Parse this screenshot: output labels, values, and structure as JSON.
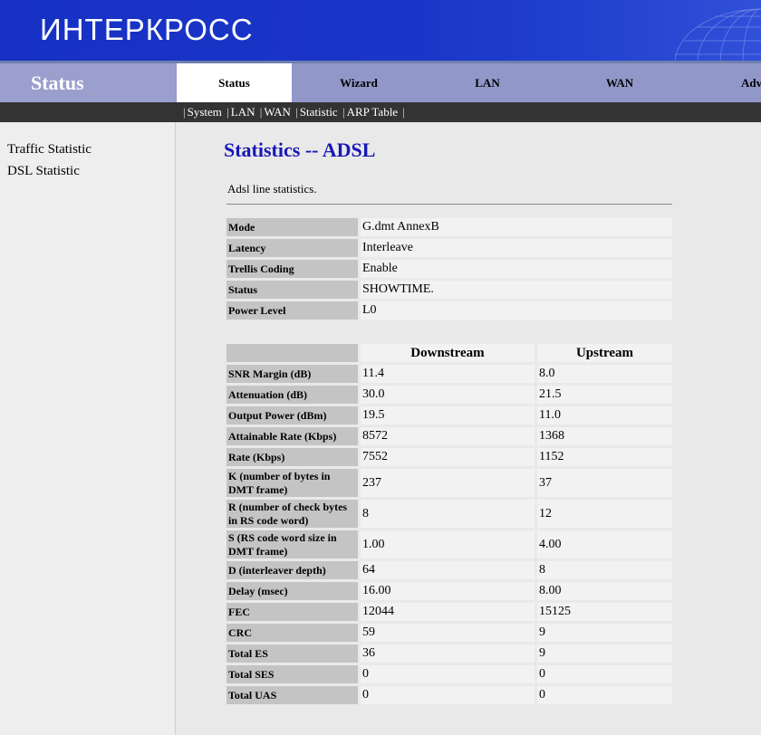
{
  "brand": {
    "logo_text": "ИНТЕРКРОСС"
  },
  "header": {
    "section_title": "Status"
  },
  "tabs": [
    {
      "label": "Status",
      "active": true
    },
    {
      "label": "Wizard",
      "active": false
    },
    {
      "label": "LAN",
      "active": false
    },
    {
      "label": "WAN",
      "active": false
    },
    {
      "label": "Adv",
      "active": false
    }
  ],
  "subnav": [
    "System",
    "LAN",
    "WAN",
    "Statistic",
    "ARP Table"
  ],
  "sidebar": {
    "items": [
      "Traffic Statistic",
      "DSL Statistic"
    ]
  },
  "page": {
    "title": "Statistics -- ADSL",
    "description": "Adsl line statistics."
  },
  "info_rows": [
    {
      "label": "Mode",
      "value": "G.dmt AnnexB"
    },
    {
      "label": "Latency",
      "value": "Interleave"
    },
    {
      "label": "Trellis Coding",
      "value": "Enable"
    },
    {
      "label": "Status",
      "value": "SHOWTIME."
    },
    {
      "label": "Power Level",
      "value": "L0"
    }
  ],
  "stats_headers": {
    "downstream": "Downstream",
    "upstream": "Upstream"
  },
  "stats_rows": [
    {
      "label": "SNR Margin (dB)",
      "down": "11.4",
      "up": "8.0"
    },
    {
      "label": "Attenuation (dB)",
      "down": "30.0",
      "up": "21.5"
    },
    {
      "label": "Output Power (dBm)",
      "down": "19.5",
      "up": "11.0"
    },
    {
      "label": "Attainable Rate (Kbps)",
      "down": "8572",
      "up": "1368"
    },
    {
      "label": "Rate (Kbps)",
      "down": "7552",
      "up": "1152"
    },
    {
      "label": "K (number of bytes in DMT frame)",
      "down": "237",
      "up": "37"
    },
    {
      "label": "R (number of check bytes in RS code word)",
      "down": "8",
      "up": "12"
    },
    {
      "label": "S (RS code word size in DMT frame)",
      "down": "1.00",
      "up": "4.00"
    },
    {
      "label": "D (interleaver depth)",
      "down": "64",
      "up": "8"
    },
    {
      "label": "Delay (msec)",
      "down": "16.00",
      "up": "8.00"
    },
    {
      "label": "FEC",
      "down": "12044",
      "up": "15125"
    },
    {
      "label": "CRC",
      "down": "59",
      "up": "9"
    },
    {
      "label": "Total ES",
      "down": "36",
      "up": "9"
    },
    {
      "label": "Total SES",
      "down": "0",
      "up": "0"
    },
    {
      "label": "Total UAS",
      "down": "0",
      "up": "0"
    }
  ],
  "colors": {
    "banner": "#1a36c8",
    "tab_bar": "#9198c9",
    "subnav": "#333333",
    "title": "#1717b8",
    "label_cell": "#c4c4c4",
    "value_cell": "#f2f2f2"
  }
}
